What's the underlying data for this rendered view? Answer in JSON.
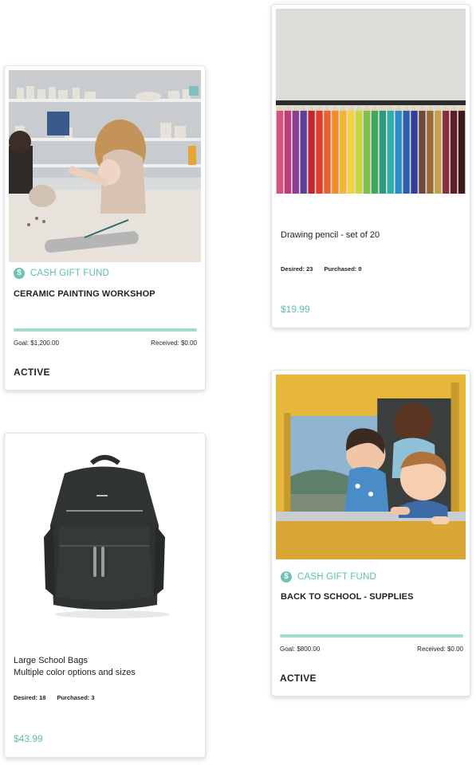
{
  "colors": {
    "accent": "#5bbfae",
    "progress_track": "#a6d9d0"
  },
  "cards": {
    "ceramic": {
      "image_desc": "ceramic-workshop-photo",
      "fund_label": "CASH GIFT FUND",
      "title": "CERAMIC PAINTING WORKSHOP",
      "progress_fraction": 0,
      "goal": "Goal: $1,200.00",
      "received": "Received: $0.00",
      "status": "ACTIVE"
    },
    "pencils": {
      "image_desc": "colored-pencils-photo",
      "title": "Drawing pencil - set of 20",
      "desired_label": "Desired:",
      "desired_value": "23",
      "purchased_label": "Purchased:",
      "purchased_value": "0",
      "price": "$19.99"
    },
    "bags": {
      "image_desc": "black-backpack-photo",
      "title_line1": "Large School Bags",
      "title_line2": "Multiple color options and sizes",
      "desired_label": "Desired:",
      "desired_value": "18",
      "purchased_label": "Purchased:",
      "purchased_value": "3",
      "price": "$43.99"
    },
    "school": {
      "image_desc": "kids-in-bus-window-photo",
      "fund_label": "CASH GIFT FUND",
      "title": "BACK TO SCHOOL - SUPPLIES",
      "progress_fraction": 0,
      "goal": "Goal: $800.00",
      "received": "Received: $0.00",
      "status": "ACTIVE"
    }
  }
}
